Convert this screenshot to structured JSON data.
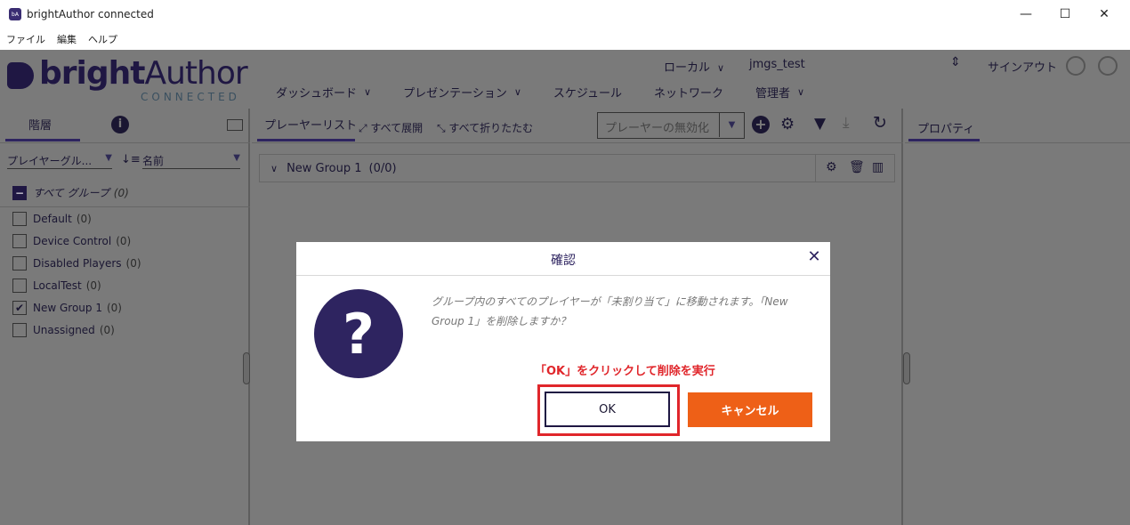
{
  "window": {
    "title": "brightAuthor connected",
    "app_icon": "bA",
    "minimize": "—",
    "maximize": "☐",
    "close": "✕"
  },
  "menu": [
    "ファイル",
    "編集",
    "ヘルプ"
  ],
  "header": {
    "logo_bright": "bright",
    "logo_author": "Author",
    "logo_sub": "CONNECTED",
    "location": "ローカル",
    "user": "jmgs_test",
    "signout": "サインアウト",
    "nav": [
      "ダッシュボード",
      "プレゼンテーション",
      "スケジュール",
      "ネットワーク",
      "管理者"
    ]
  },
  "left": {
    "tab": "階層",
    "filter_group": "プレイヤーグル...",
    "sort_by": "名前",
    "all_groups_label": "すべて グループ",
    "all_groups_count": "(0)",
    "groups": [
      {
        "name": "Default",
        "count": "(0)",
        "checked": false
      },
      {
        "name": "Device Control",
        "count": "(0)",
        "checked": false
      },
      {
        "name": "Disabled Players",
        "count": "(0)",
        "checked": false
      },
      {
        "name": "LocalTest",
        "count": "(0)",
        "checked": false
      },
      {
        "name": "New Group 1",
        "count": "(0)",
        "checked": true
      },
      {
        "name": "Unassigned",
        "count": "(0)",
        "checked": false
      }
    ]
  },
  "middle": {
    "tab": "プレーヤーリスト",
    "expand_all": "すべて展開",
    "collapse_all": "すべて折りたたむ",
    "disable_player": "プレーヤーの無効化",
    "group_row": "New Group 1",
    "group_row_count": "(0/0)"
  },
  "right": {
    "tab": "プロパティ"
  },
  "dialog": {
    "title": "確認",
    "message": "グループ内のすべてのプレイヤーが「未割り当て」に移動されます。「New Group 1」を削除しますか？",
    "annotation": "「OK」をクリックして削除を実行",
    "ok": "OK",
    "cancel": "キャンセル",
    "close": "✕",
    "question": "?"
  },
  "colors": {
    "brand": "#1f1743",
    "accent_orange": "#ee6017",
    "annotation_red": "#e0262b"
  }
}
